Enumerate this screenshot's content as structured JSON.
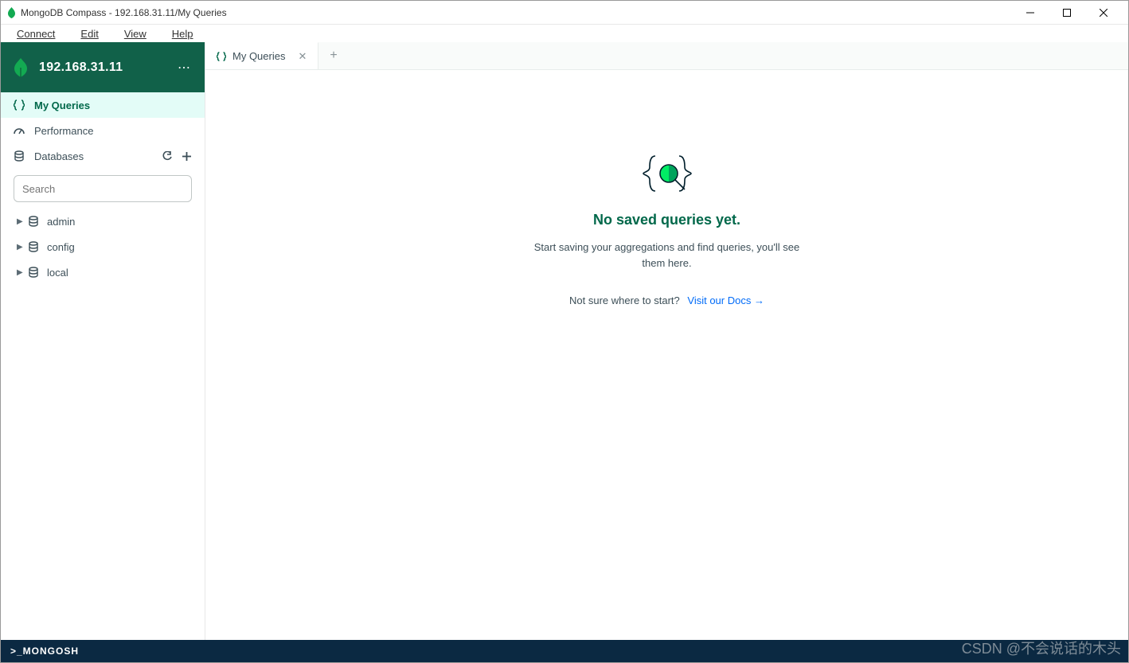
{
  "window": {
    "title": "MongoDB Compass - 192.168.31.11/My Queries"
  },
  "menubar": {
    "connect": "Connect",
    "edit": "Edit",
    "view": "View",
    "help": "Help"
  },
  "connection": {
    "host": "192.168.31.11"
  },
  "sidebar": {
    "my_queries": "My Queries",
    "performance": "Performance",
    "databases": "Databases",
    "search_placeholder": "Search",
    "dbs": [
      {
        "name": "admin"
      },
      {
        "name": "config"
      },
      {
        "name": "local"
      }
    ]
  },
  "tabs": {
    "active": {
      "label": "My Queries"
    }
  },
  "empty_state": {
    "title": "No saved queries yet.",
    "description": "Start saving your aggregations and find queries, you'll see them here.",
    "hint": "Not sure where to start?",
    "link_text": "Visit our Docs →"
  },
  "footer": {
    "shell_label": ">_MONGOSH"
  },
  "watermark": "CSDN @不会说话的木头"
}
